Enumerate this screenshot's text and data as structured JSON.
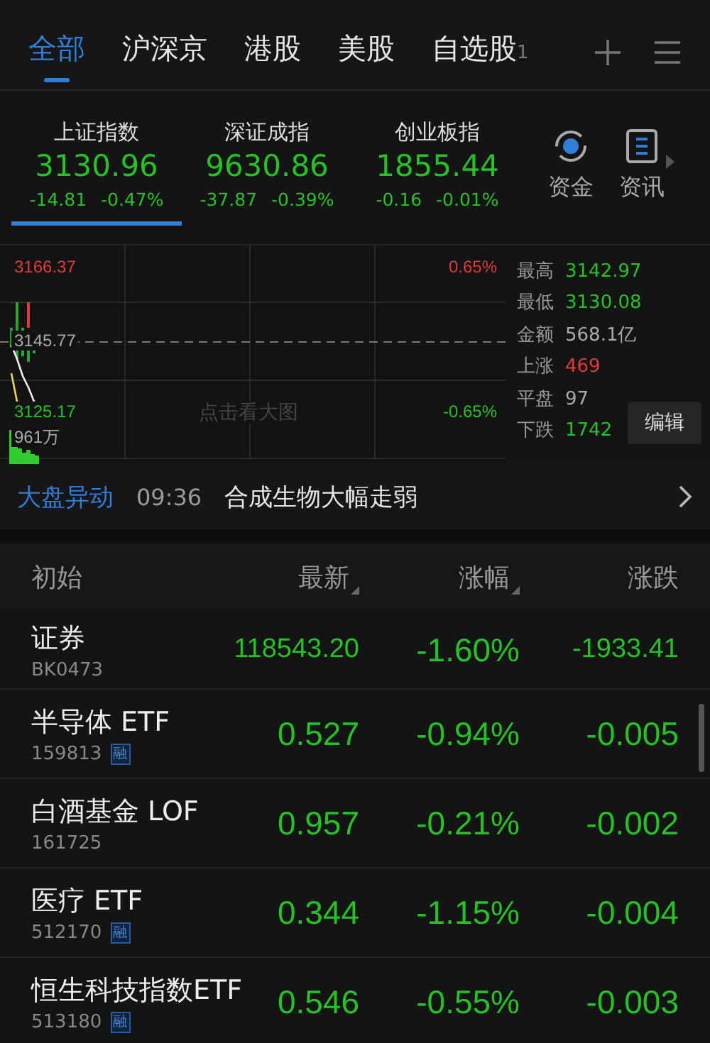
{
  "tabs": [
    {
      "label": "全部",
      "selected": true
    },
    {
      "label": "沪深京",
      "selected": false
    },
    {
      "label": "港股",
      "selected": false
    },
    {
      "label": "美股",
      "selected": false
    },
    {
      "label": "自选股",
      "badge": "1",
      "selected": false
    }
  ],
  "indices": [
    {
      "name": "上证指数",
      "value": "3130.96",
      "change": "-14.81",
      "percent": "-0.47%",
      "color": "#25c225",
      "selected": true
    },
    {
      "name": "深证成指",
      "value": "9630.86",
      "change": "-37.87",
      "percent": "-0.39%",
      "color": "#25c225",
      "selected": false
    },
    {
      "name": "创业板指",
      "value": "1855.44",
      "change": "-0.16",
      "percent": "-0.01%",
      "color": "#25c225",
      "selected": false
    }
  ],
  "shortcuts": [
    {
      "kind": "funds",
      "label": "资金"
    },
    {
      "kind": "news",
      "label": "资讯"
    }
  ],
  "chart": {
    "top_price": "3166.37",
    "mid_price": "3145.77",
    "bottom_price": "3125.17",
    "top_percent": "0.65%",
    "bottom_percent": "-0.65%",
    "volume": "961万",
    "hint": "点击看大图"
  },
  "stats": [
    {
      "label": "最高",
      "value": "3142.97",
      "color": "#25c225"
    },
    {
      "label": "最低",
      "value": "3130.08",
      "color": "#25c225"
    },
    {
      "label": "金额",
      "value": "568.1亿",
      "color": "#aaaaaa"
    },
    {
      "label": "上涨",
      "value": "469",
      "color": "#e03a3a"
    },
    {
      "label": "平盘",
      "value": "97",
      "color": "#aaaaaa"
    },
    {
      "label": "下跌",
      "value": "1742",
      "color": "#25c225"
    }
  ],
  "edit_button": "编辑",
  "alert": {
    "title": "大盘异动",
    "time": "09:36",
    "text": "合成生物大幅走弱"
  },
  "table": {
    "columns": [
      {
        "label": "初始",
        "sortable": false
      },
      {
        "label": "最新",
        "sortable": true
      },
      {
        "label": "涨幅",
        "sortable": true
      },
      {
        "label": "涨跌",
        "sortable": false
      }
    ],
    "rows": [
      {
        "name": "证券",
        "code": "BK0473",
        "margin": false,
        "price": "118543.20",
        "percent": "-1.60%",
        "change": "-1933.41",
        "color": "#25c225"
      },
      {
        "name": "半导体 ETF",
        "code": "159813",
        "margin": true,
        "margin_label": "融",
        "price": "0.527",
        "percent": "-0.94%",
        "change": "-0.005",
        "color": "#25c225"
      },
      {
        "name": "白酒基金 LOF",
        "code": "161725",
        "margin": false,
        "price": "0.957",
        "percent": "-0.21%",
        "change": "-0.002",
        "color": "#25c225"
      },
      {
        "name": "医疗 ETF",
        "code": "512170",
        "margin": true,
        "margin_label": "融",
        "price": "0.344",
        "percent": "-1.15%",
        "change": "-0.004",
        "color": "#25c225"
      },
      {
        "name": "恒生科技指数ETF",
        "code": "513180",
        "margin": true,
        "margin_label": "融",
        "price": "0.546",
        "percent": "-0.55%",
        "change": "-0.003",
        "color": "#25c225"
      }
    ]
  }
}
